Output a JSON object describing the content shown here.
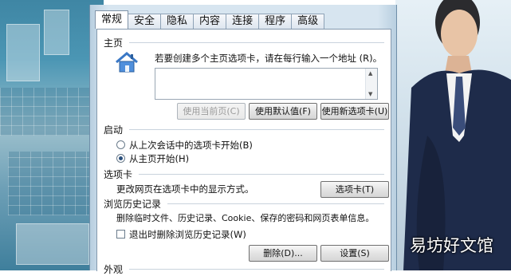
{
  "tabs": [
    "常规",
    "安全",
    "隐私",
    "内容",
    "连接",
    "程序",
    "高级"
  ],
  "homepage": {
    "title": "主页",
    "description": "若要创建多个主页选项卡，请在每行输入一个地址 (R)。",
    "address_value": "",
    "btn_current": "使用当前页(C)",
    "btn_default": "使用默认值(F)",
    "btn_new_tab": "使用新选项卡(U)"
  },
  "startup": {
    "title": "启动",
    "option_last_session": "从上次会话中的选项卡开始(B)",
    "option_home": "从主页开始(H)",
    "selected": "option_home"
  },
  "tabs_section": {
    "title": "选项卡",
    "description": "更改网页在选项卡中的显示方式。",
    "button": "选项卡(T)"
  },
  "history": {
    "title": "浏览历史记录",
    "description": "删除临时文件、历史记录、Cookie、保存的密码和网页表单信息。",
    "checkbox_label": "退出时删除浏览历史记录(W)",
    "checkbox_checked": false,
    "btn_delete": "删除(D)...",
    "btn_settings": "设置(S)"
  },
  "appearance": {
    "title": "外观"
  },
  "watermark": "易坊好文馆",
  "colors": {
    "dialog_bg": "#d7e5f0",
    "panel_bg": "#ffffff",
    "radio_dot": "#2a4f7c"
  }
}
